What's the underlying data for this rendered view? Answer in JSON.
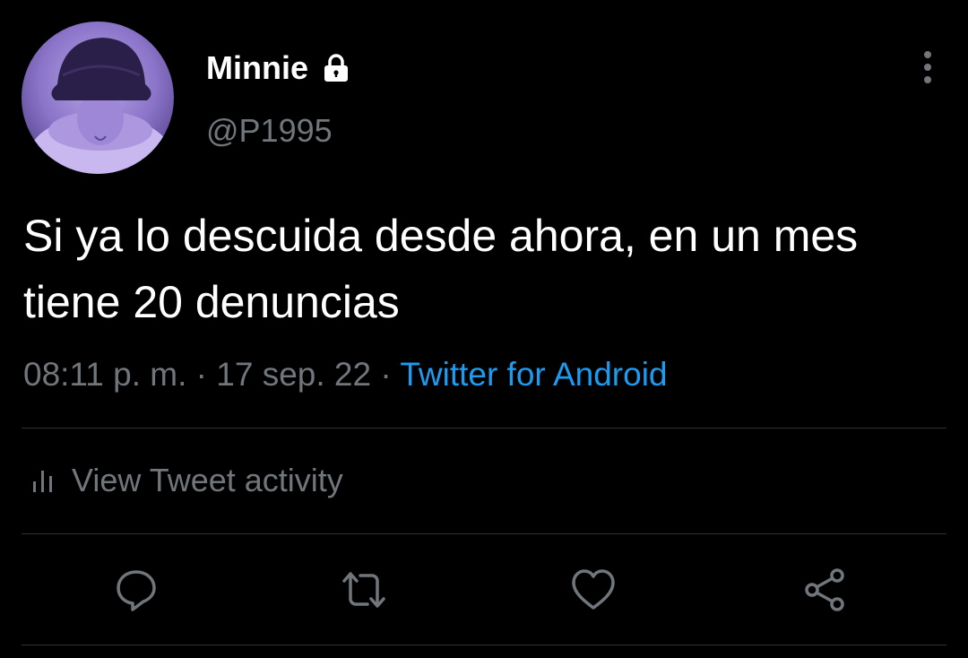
{
  "user": {
    "display_name": "Minnie",
    "handle": "@P1995",
    "avatar": "profile-photo",
    "locked_icon": "lock-icon"
  },
  "tweet": {
    "text": "Si ya lo descuida desde ahora, en un mes tiene 20 denuncias",
    "time": "08:11 p. m.",
    "separator": "·",
    "date": "17 sep. 22",
    "source": "Twitter for Android"
  },
  "activity": {
    "label": "View Tweet activity",
    "icon": "bar-chart-icon"
  },
  "actions": [
    {
      "name": "reply",
      "icon": "reply-icon"
    },
    {
      "name": "retweet",
      "icon": "retweet-icon"
    },
    {
      "name": "like",
      "icon": "heart-icon"
    },
    {
      "name": "share",
      "icon": "share-icon"
    }
  ],
  "colors": {
    "background": "#000000",
    "primary_text": "#ffffff",
    "secondary_text": "#71767b",
    "link": "#1d9bf0",
    "divider": "#2f3336"
  }
}
